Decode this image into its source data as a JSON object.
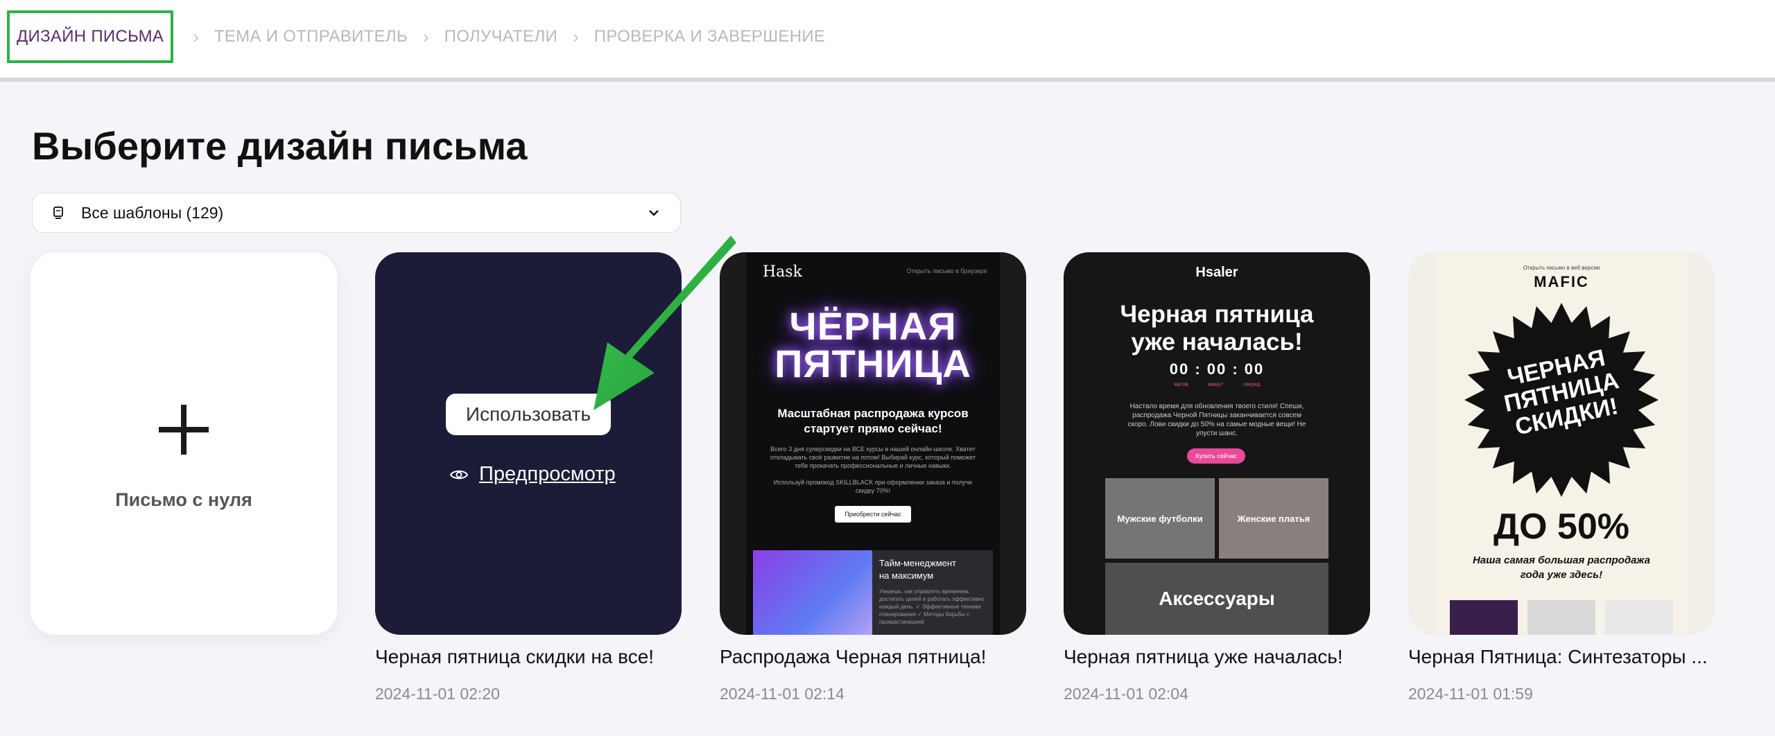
{
  "steps": [
    {
      "label": "ДИЗАЙН ПИСЬМА",
      "active": true
    },
    {
      "label": "ТЕМА И ОТПРАВИТЕЛЬ",
      "active": false
    },
    {
      "label": "ПОЛУЧАТЕЛИ",
      "active": false
    },
    {
      "label": "ПРОВЕРКА И ЗАВЕРШЕНИЕ",
      "active": false
    }
  ],
  "page_title": "Выберите дизайн письма",
  "filter": {
    "label": "Все шаблоны (129)",
    "icon": "template-icon",
    "chevron": "chevron-down-icon"
  },
  "new_card": {
    "label": "Письмо с нуля",
    "icon": "plus-icon"
  },
  "hover_actions": {
    "use_label": "Использовать",
    "preview_label": "Предпросмотр",
    "preview_icon": "eye-icon"
  },
  "templates": [
    {
      "name": "Черная пятница скидки на все!",
      "date": "2024-11-01 02:20"
    },
    {
      "name": "Распродажа Черная пятница!",
      "date": "2024-11-01 02:14"
    },
    {
      "name": "Черная пятница уже началась!",
      "date": "2024-11-01 02:04"
    },
    {
      "name": "Черная Пятница: Синтезаторы ...",
      "date": "2024-11-01 01:59"
    }
  ],
  "thumb_hask": {
    "logo": "Hask",
    "link": "Открыть письмо в браузере",
    "headline_1": "ЧЁРНАЯ",
    "headline_2": "ПЯТНИЦА",
    "sub_1": "Масштабная распродажа курсов",
    "sub_2": "стартует прямо сейчас!",
    "para_1": "Всего 3 дня суперскидки на ВСЕ курсы в нашей онлайн-школе. Хватит откладывать своё развитие на потом! Выбирай курс, который поможет тебе прокачать профессиональные и личные навыки.",
    "para_2": "Используй промокод SKILLBLACK при оформлении заказа и получи скидку 70%!",
    "button": "Приобрести сейчас",
    "box_title_1": "Тайм-менеджмент",
    "box_title_2": "на максимум",
    "box_text": "Узнаешь, как управлять временем, достигать целей и работать эффективно каждый день.  ✓ Эффективные техники планирования  ✓ Методы борьбы с прокрастинацией"
  },
  "thumb_hsaler": {
    "logo": "Hsaler",
    "headline_1": "Черная пятница",
    "headline_2": "уже началась!",
    "timer": "00 : 00 : 00",
    "timer_labels": "часов минут секунд",
    "para": "Настало время для обновления твоего стиля! Спеши, распродажа Черной Пятницы заканчивается совсем скоро. Лови скидки до 50% на самые модные вещи! Не упусти шанс.",
    "button": "Купить сейчас",
    "tile_1": "Мужские футболки",
    "tile_2": "Женские платья",
    "tile_3": "Аксессуары"
  },
  "thumb_mafic": {
    "top": "Открыть письмо в веб версии",
    "logo": "MAFIC",
    "star_1": "ЧЕРНАЯ",
    "star_2": "ПЯТНИЦА",
    "star_3": "СКИДКИ!",
    "percent": "ДО 50%",
    "sub_1": "Наша самая большая распродажа",
    "sub_2": "года уже здесь!"
  },
  "colors": {
    "active_step": "#5b2a6e",
    "highlight_box": "#2fb14a",
    "arrow": "#2fb14a",
    "card_dark": "#1c1c38",
    "pink": "#e94a9a",
    "hask_glow": "#a86bff"
  }
}
